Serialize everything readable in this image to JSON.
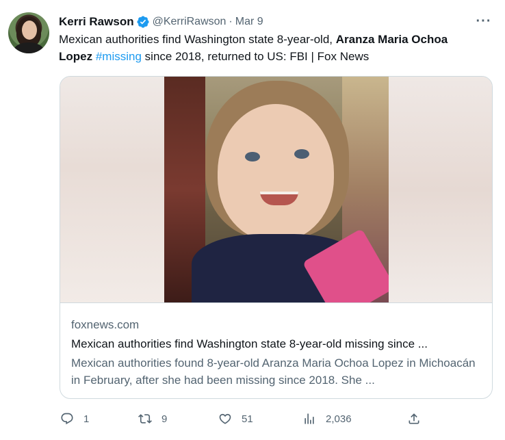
{
  "author": {
    "name": "Kerri Rawson",
    "handle": "@KerriRawson",
    "separator": "·",
    "date": "Mar 9",
    "verified_color": "#1d9bf0"
  },
  "tweet": {
    "text_part1": "Mexican authorities find Washington state 8-year-old, ",
    "text_bold": "Aranza Maria Ochoa Lopez",
    "text_space": " ",
    "hashtag": "#missing",
    "text_part2": " since 2018, returned to US: FBI | Fox News"
  },
  "card": {
    "domain": "foxnews.com",
    "title": "Mexican authorities find Washington state 8-year-old missing since ...",
    "description": "Mexican authorities found 8-year-old Aranza Maria Ochoa Lopez in Michoacán in February, after she had been missing since 2018. She ..."
  },
  "actions": {
    "replies": "1",
    "retweets": "9",
    "likes": "51",
    "views": "2,036"
  },
  "icons": {
    "more": "more-icon",
    "reply": "reply-icon",
    "retweet": "retweet-icon",
    "like": "heart-icon",
    "views": "views-icon",
    "share": "share-icon"
  },
  "colors": {
    "accent": "#1d9bf0",
    "secondary_text": "#536471",
    "primary_text": "#0f1419",
    "border": "#cfd9de"
  }
}
